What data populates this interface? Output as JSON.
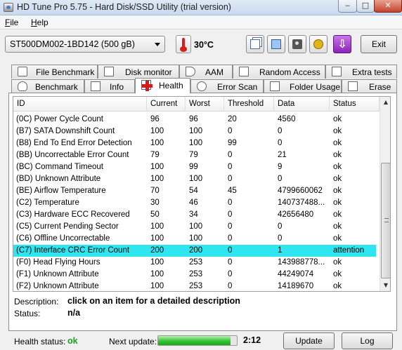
{
  "window": {
    "title": "HD Tune Pro 5.75 - Hard Disk/SSD Utility (trial version)"
  },
  "menu": {
    "file": "File",
    "help": "Help"
  },
  "toolbar": {
    "drive": "ST500DM002-1BD142 (500 gB)",
    "temperature": "30°C",
    "exit_label": "Exit",
    "icons": [
      "copy-icon",
      "save-icon",
      "camera-icon",
      "options-icon",
      "download-icon"
    ]
  },
  "tabs": {
    "row1": [
      "File Benchmark",
      "Disk monitor",
      "AAM",
      "Random Access",
      "Extra tests"
    ],
    "row2": [
      "Benchmark",
      "Info",
      "Health",
      "Error Scan",
      "Folder Usage",
      "Erase"
    ],
    "active": "Health"
  },
  "table": {
    "headers": [
      "ID",
      "Current",
      "Worst",
      "Threshold",
      "Data",
      "Status"
    ],
    "rows": [
      [
        "(0C) Power Cycle Count",
        "96",
        "96",
        "20",
        "4560",
        "ok"
      ],
      [
        "(B7) SATA Downshift Count",
        "100",
        "100",
        "0",
        "0",
        "ok"
      ],
      [
        "(B8) End To End Error Detection",
        "100",
        "100",
        "99",
        "0",
        "ok"
      ],
      [
        "(BB) Uncorrectable Error Count",
        "79",
        "79",
        "0",
        "21",
        "ok"
      ],
      [
        "(BC) Command Timeout",
        "100",
        "99",
        "0",
        "9",
        "ok"
      ],
      [
        "(BD) Unknown Attribute",
        "100",
        "100",
        "0",
        "0",
        "ok"
      ],
      [
        "(BE) Airflow Temperature",
        "70",
        "54",
        "45",
        "4799660062",
        "ok"
      ],
      [
        "(C2) Temperature",
        "30",
        "46",
        "0",
        "140737488...",
        "ok"
      ],
      [
        "(C3) Hardware ECC Recovered",
        "50",
        "34",
        "0",
        "42656480",
        "ok"
      ],
      [
        "(C5) Current Pending Sector",
        "100",
        "100",
        "0",
        "0",
        "ok"
      ],
      [
        "(C6) Offline Uncorrectable",
        "100",
        "100",
        "0",
        "0",
        "ok"
      ],
      [
        "(C7) Interface CRC Error Count",
        "200",
        "200",
        "0",
        "1",
        "attention"
      ],
      [
        "(F0) Head Flying Hours",
        "100",
        "253",
        "0",
        "143988778...",
        "ok"
      ],
      [
        "(F1) Unknown Attribute",
        "100",
        "253",
        "0",
        "44249074",
        "ok"
      ],
      [
        "(F2) Unknown Attribute",
        "100",
        "253",
        "0",
        "14189670",
        "ok"
      ]
    ],
    "highlight_row": 11,
    "highlight_color": "#2fe6f0"
  },
  "details": {
    "description_label": "Description:",
    "description_value": "click on an item for a detailed description",
    "status_label": "Status:",
    "status_value": "n/a"
  },
  "footer": {
    "health_label": "Health status:",
    "health_value": "ok",
    "health_color": "#1aa31a",
    "next_update_label": "Next update:",
    "next_update_progress": 0.92,
    "countdown": "2:12",
    "update_label": "Update",
    "log_label": "Log"
  }
}
